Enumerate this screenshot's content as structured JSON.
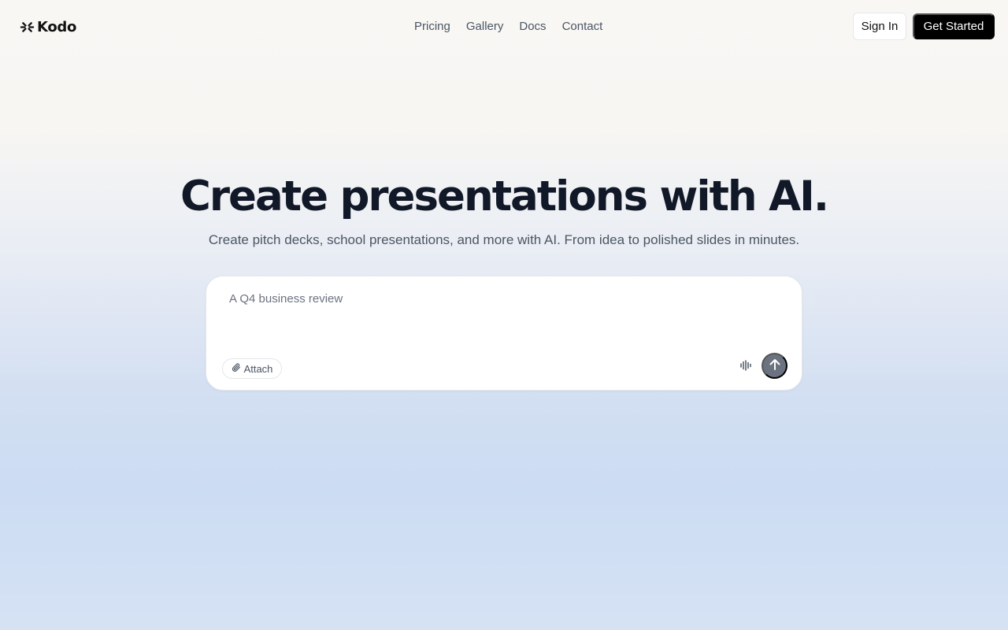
{
  "brand": {
    "name": "Kodo",
    "logo_icon": "asterisk-logo-icon"
  },
  "nav": {
    "links": [
      {
        "label": "Pricing"
      },
      {
        "label": "Gallery"
      },
      {
        "label": "Docs"
      },
      {
        "label": "Contact"
      }
    ],
    "signin_label": "Sign In",
    "get_started_label": "Get Started"
  },
  "hero": {
    "title": "Create presentations with AI.",
    "subtitle": "Create pitch decks, school presentations, and more with AI. From idea to polished slides in minutes."
  },
  "prompt": {
    "placeholder": "A Q4 business review",
    "value": "",
    "attach_label": "Attach",
    "attach_icon": "paperclip-icon",
    "voice_icon": "voice-waveform-icon",
    "send_icon": "arrow-up-icon"
  },
  "colors": {
    "primary_button": "#000000",
    "send_button": "#6b7280",
    "title_text": "#111827",
    "muted_text": "#4b5563"
  }
}
